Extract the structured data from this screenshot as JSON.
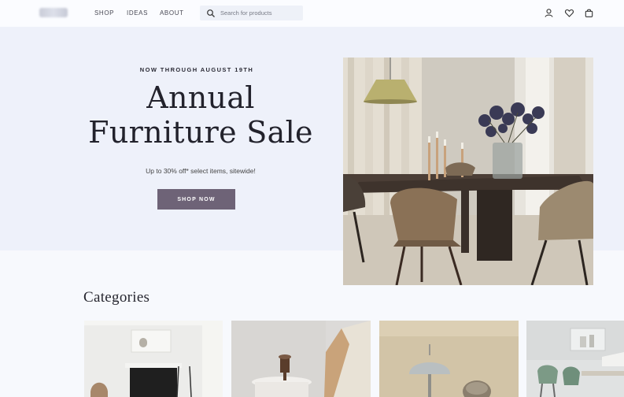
{
  "nav": {
    "links": [
      "SHOP",
      "IDEAS",
      "ABOUT"
    ],
    "search": {
      "placeholder": "Search for products"
    },
    "icons": [
      "search-icon",
      "user-icon",
      "heart-icon",
      "bag-icon"
    ]
  },
  "hero": {
    "eyebrow": "NOW THROUGH AUGUST 19TH",
    "headline_line1": "Annual",
    "headline_line2": "Furniture Sale",
    "subtext": "Up to 30% off* select items, sitewide!",
    "cta_label": "SHOP NOW"
  },
  "categories": {
    "title": "Categories",
    "cards": [
      "category-card-living",
      "category-card-accent",
      "category-card-lighting",
      "category-card-dining"
    ]
  },
  "colors": {
    "background": "#f7f9fd",
    "hero_background": "#eef1fa",
    "cta": "#6e6377",
    "text": "#22222c"
  }
}
